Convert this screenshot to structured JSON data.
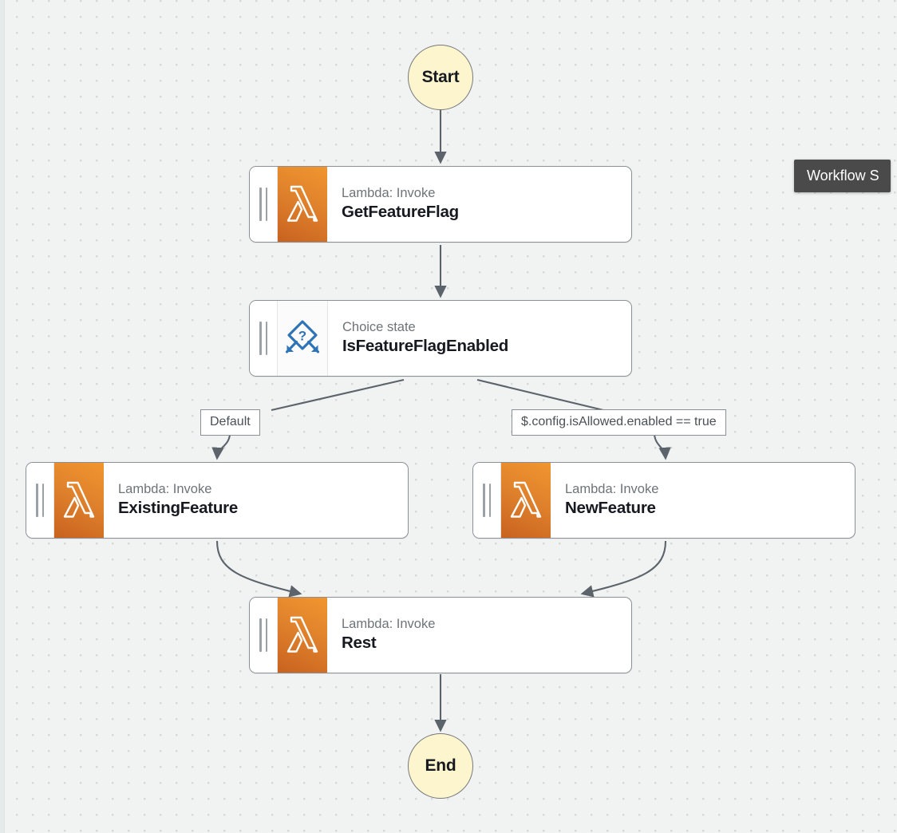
{
  "canvas": {
    "background_color": "#f1f3f3",
    "grid_dot_color": "#d5dadb",
    "grid_spacing_px": 20
  },
  "colors": {
    "lambda_orange_light": "#f0962f",
    "lambda_orange_dark": "#c8621f",
    "choice_blue": "#2e73b8",
    "terminal_fill": "#fdf5ce",
    "node_border": "#8a9096",
    "connector": "#5c636b",
    "tooltip_background": "#4a4a4a"
  },
  "tooltip": {
    "text": "Workflow S",
    "full_text_clipped": true
  },
  "start_node": {
    "label": "Start",
    "icon": "circle"
  },
  "end_node": {
    "label": "End",
    "icon": "circle"
  },
  "nodes": [
    {
      "id": "get-feature-flag",
      "kind": "Lambda: Invoke",
      "title": "GetFeatureFlag",
      "icon": "lambda-icon"
    },
    {
      "id": "is-feature-flag-enabled",
      "kind": "Choice state",
      "title": "IsFeatureFlagEnabled",
      "icon": "choice-icon"
    },
    {
      "id": "existing-feature",
      "kind": "Lambda: Invoke",
      "title": "ExistingFeature",
      "icon": "lambda-icon"
    },
    {
      "id": "new-feature",
      "kind": "Lambda: Invoke",
      "title": "NewFeature",
      "icon": "lambda-icon"
    },
    {
      "id": "rest",
      "kind": "Lambda: Invoke",
      "title": "Rest",
      "icon": "lambda-icon"
    }
  ],
  "edge_labels": [
    {
      "id": "default",
      "text": "Default"
    },
    {
      "id": "condition-true",
      "text": "$.config.isAllowed.enabled == true"
    }
  ]
}
